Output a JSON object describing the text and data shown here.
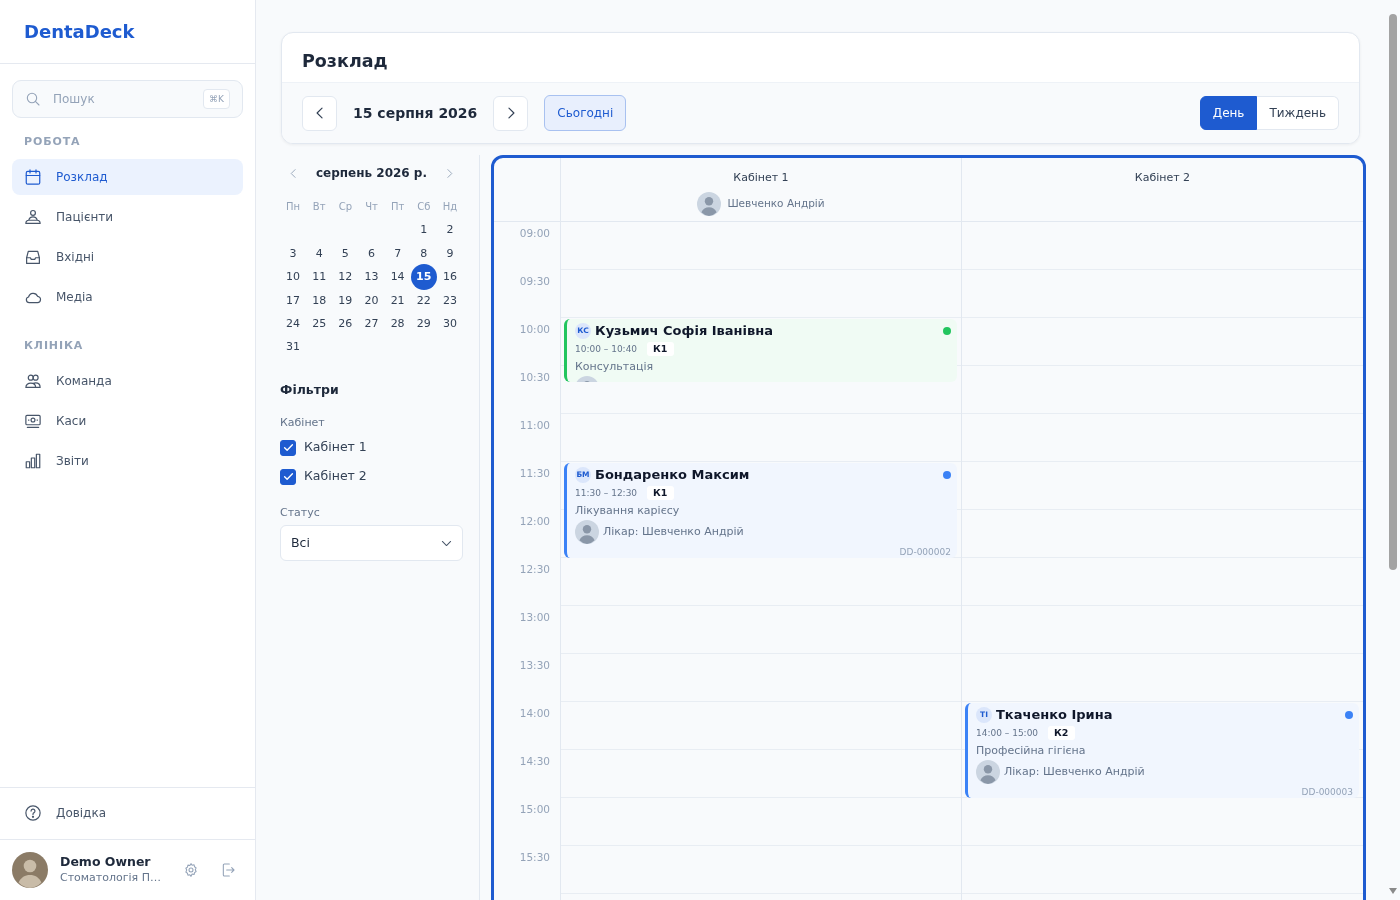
{
  "sidebar": {
    "logo": "DentaDeck",
    "search": {
      "placeholder": "Пошук",
      "shortcut": "⌘K"
    },
    "sections": [
      {
        "title": "РОБОТА",
        "items": [
          {
            "label": "Розклад",
            "selected": true
          },
          {
            "label": "Пацієнти",
            "selected": false
          },
          {
            "label": "Вхідні",
            "selected": false
          },
          {
            "label": "Медіа",
            "selected": false
          }
        ]
      },
      {
        "title": "КЛІНІКА",
        "items": [
          {
            "label": "Команда",
            "selected": false
          },
          {
            "label": "Каси",
            "selected": false
          },
          {
            "label": "Звіти",
            "selected": false
          }
        ]
      }
    ],
    "help": {
      "label": "Довідка"
    },
    "user": {
      "name": "Demo Owner",
      "subtitle": "Стоматологія П…"
    }
  },
  "header": {
    "title": "Розклад",
    "date": "15 серпня 2026",
    "today": "Сьогодні",
    "views": [
      {
        "label": "День",
        "selected": true
      },
      {
        "label": "Тиждень",
        "selected": false
      }
    ]
  },
  "calendar": {
    "month": "серпень 2026 р.",
    "weekdays": [
      "Пн",
      "Вт",
      "Ср",
      "Чт",
      "Пт",
      "Сб",
      "Нд"
    ],
    "weeks": [
      [
        {
          "day": "1",
          "selected": false
        },
        {
          "day": "2",
          "selected": false
        }
      ],
      [
        {
          "day": "3",
          "selected": false
        },
        {
          "day": "4",
          "selected": false
        },
        {
          "day": "5",
          "selected": false
        },
        {
          "day": "6",
          "selected": false
        },
        {
          "day": "7",
          "selected": false
        },
        {
          "day": "8",
          "selected": false
        },
        {
          "day": "9",
          "selected": false
        }
      ],
      [
        {
          "day": "10",
          "selected": false
        },
        {
          "day": "11",
          "selected": false
        },
        {
          "day": "12",
          "selected": false
        },
        {
          "day": "13",
          "selected": false
        },
        {
          "day": "14",
          "selected": false
        },
        {
          "day": "15",
          "selected": true
        },
        {
          "day": "16",
          "selected": false
        }
      ],
      [
        {
          "day": "17",
          "selected": false
        },
        {
          "day": "18",
          "selected": false
        },
        {
          "day": "19",
          "selected": false
        },
        {
          "day": "20",
          "selected": false
        },
        {
          "day": "21",
          "selected": false
        },
        {
          "day": "22",
          "selected": false
        },
        {
          "day": "23",
          "selected": false
        }
      ],
      [
        {
          "day": "24",
          "selected": false
        },
        {
          "day": "25",
          "selected": false
        },
        {
          "day": "26",
          "selected": false
        },
        {
          "day": "27",
          "selected": false
        },
        {
          "day": "28",
          "selected": false
        },
        {
          "day": "29",
          "selected": false
        },
        {
          "day": "30",
          "selected": false
        }
      ],
      [
        {
          "day": "31",
          "selected": false
        }
      ]
    ]
  },
  "filters": {
    "title": "Фільтри",
    "room_label": "Кабінет",
    "rooms": [
      {
        "label": "Кабінет 1",
        "checked": true
      },
      {
        "label": "Кабінет 2",
        "checked": true
      }
    ],
    "status_label": "Статус",
    "status_value": "Всі"
  },
  "schedule": {
    "times": [
      "09:00",
      "09:30",
      "10:00",
      "10:30",
      "11:00",
      "11:30",
      "12:00",
      "12:30",
      "13:00",
      "13:30",
      "14:00",
      "14:30",
      "15:00",
      "15:30"
    ],
    "columns": [
      {
        "title": "Кабінет 1",
        "doctor": "Шевченко Андрій",
        "appointments": [
          {
            "initials": "КС",
            "patient": "Кузьмич Софія Іванівна",
            "time": "10:00 – 10:40",
            "room": "К1",
            "service": "Консультація",
            "color": "#22c55e",
            "doctor_avatar": true
          },
          {
            "initials": "БМ",
            "patient": "Бондаренко Максим",
            "time": "11:30 – 12:30",
            "room": "К1",
            "service": "Лікування карієсу",
            "color": "#3b82f6",
            "doctor_avatar": true,
            "doctor": "Лікар: Шевченко Андрій",
            "code": "DD-000002"
          }
        ]
      },
      {
        "title": "Кабінет 2",
        "appointments": [
          {
            "initials": "ТІ",
            "patient": "Ткаченко Ірина",
            "time": "14:00 – 15:00",
            "room": "К2",
            "service": "Професійна гігієна",
            "color": "#3b82f6",
            "doctor_avatar": true,
            "doctor": "Лікар: Шевченко Андрій",
            "code": "DD-000003"
          }
        ]
      }
    ]
  }
}
